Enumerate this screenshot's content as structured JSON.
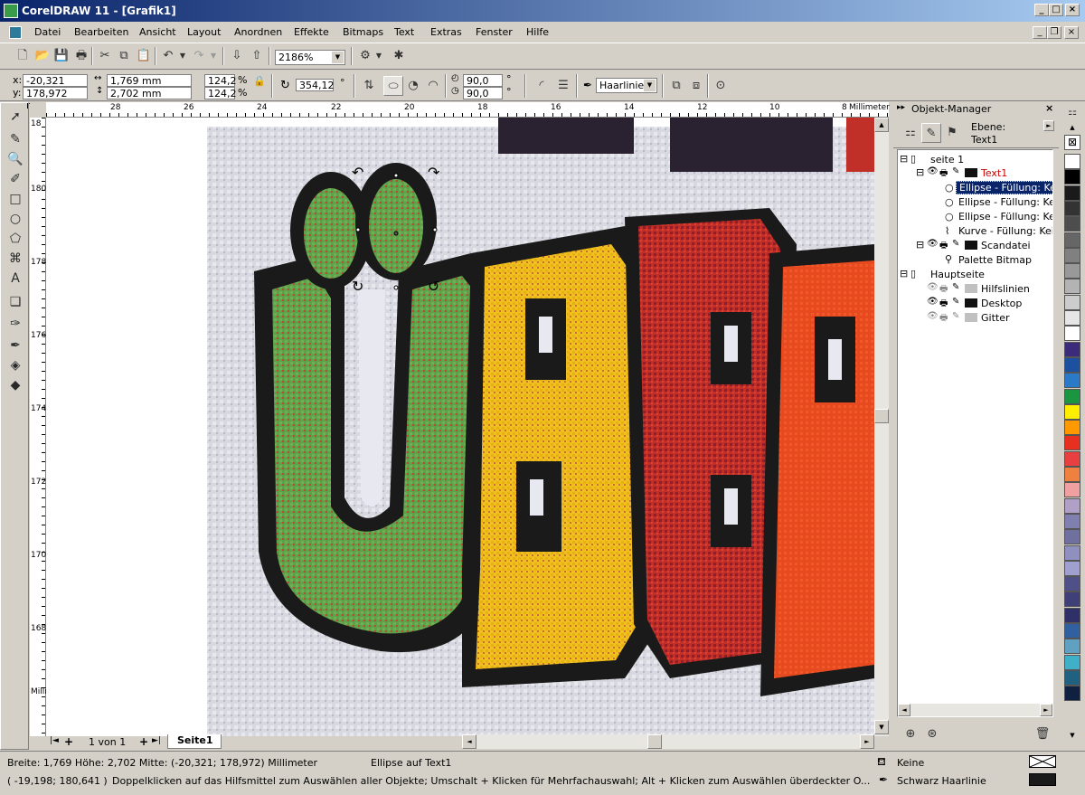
{
  "window": {
    "title": "CorelDRAW 11 - [Grafik1]"
  },
  "menu": [
    "Datei",
    "Bearbeiten",
    "Ansicht",
    "Layout",
    "Anordnen",
    "Effekte",
    "Bitmaps",
    "Text",
    "Extras",
    "Fenster",
    "Hilfe"
  ],
  "toolbar": {
    "zoom": "2186%"
  },
  "props": {
    "x_label": "x:",
    "y_label": "y:",
    "x": "-20,321 mm",
    "y": "178,972 mm",
    "width": "1,769 mm",
    "height": "2,702 mm",
    "scale_w": "124,2",
    "scale_h": "124,2",
    "percent": "%",
    "rotation": "354,12",
    "degree": "°",
    "angle1": "90,0",
    "angle2": "90,0",
    "outline": "Haarlinie"
  },
  "ruler": {
    "unit": "Millimeter",
    "h_ticks": [
      "28",
      "26",
      "24",
      "22",
      "20",
      "18",
      "16",
      "14",
      "12",
      "10",
      "8"
    ],
    "v_ticks": [
      "180",
      "178",
      "176",
      "174",
      "172",
      "170",
      "168"
    ],
    "v_top": "18"
  },
  "page_nav": {
    "first": "|◄",
    "prev": "◄",
    "page": "1 von 1",
    "next": "►",
    "last": "►|",
    "tab": "Seite1"
  },
  "docker": {
    "title": "Objekt-Manager",
    "layer_label": "Ebene:",
    "layer_value": "Text1",
    "tree": [
      {
        "label": "seite 1"
      },
      {
        "label": "Text1"
      },
      {
        "label": "Ellipse - Füllung: Kein"
      },
      {
        "label": "Ellipse - Füllung: Kein"
      },
      {
        "label": "Ellipse - Füllung: Kein"
      },
      {
        "label": "Kurve - Füllung: Kein"
      },
      {
        "label": "Scandatei"
      },
      {
        "label": "Palette Bitmap"
      },
      {
        "label": "Hauptseite"
      },
      {
        "label": "Hilfslinien"
      },
      {
        "label": "Desktop"
      },
      {
        "label": "Gitter"
      }
    ]
  },
  "status": {
    "dims": "Breite: 1,769  Höhe: 2,702  Mitte: (-20,321; 178,972) Millimeter",
    "object": "Ellipse auf Text1",
    "coords": "( -19,198; 180,641 )",
    "hint": "Doppelklicken auf das Hilfsmittel zum Auswählen aller Objekte; Umschalt + Klicken für Mehrfachauswahl; Alt + Klicken zum Auswählen überdeckter O...",
    "fill": "Keine",
    "outline": "Schwarz  Haarlinie"
  },
  "palette_colors": [
    "#ffffff",
    "#000000",
    "#1a1a1a",
    "#333333",
    "#4d4d4d",
    "#666666",
    "#808080",
    "#999999",
    "#b3b3b3",
    "#cccccc",
    "#e6e6e6",
    "#ffffff",
    "#3c2a7a",
    "#1e50a0",
    "#2a7ac8",
    "#1a9640",
    "#ffee00",
    "#ff9900",
    "#e83020",
    "#e84040",
    "#f08040",
    "#f0a0a0",
    "#b0a0c8",
    "#8080b0",
    "#7070a0",
    "#9090c0",
    "#a0a0d0",
    "#505088",
    "#404078",
    "#303068",
    "#3060a0",
    "#60a0c0",
    "#40b0c8",
    "#206080",
    "#102040"
  ]
}
